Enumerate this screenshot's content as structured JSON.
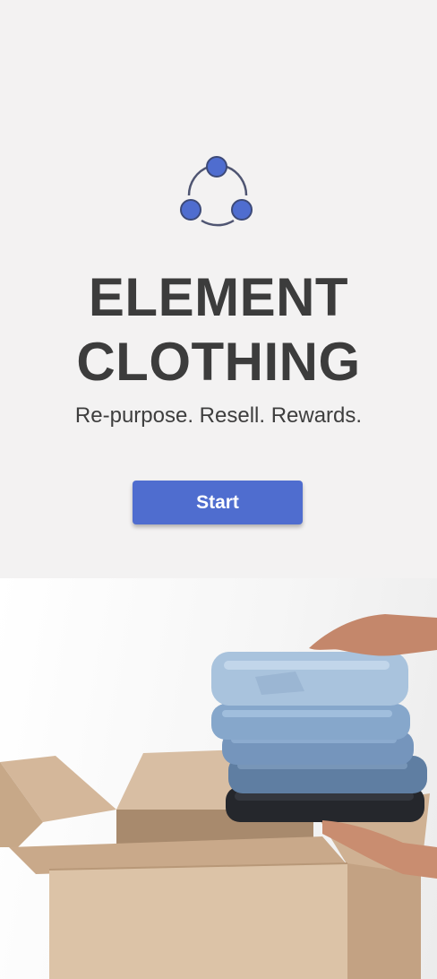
{
  "brand": {
    "title_line1": "ELEMENT",
    "title_line2": "CLOTHING",
    "tagline": "Re-purpose. Resell. Rewards.",
    "logo_icon": "share-network-icon",
    "accent_color": "#4f6dcf"
  },
  "actions": {
    "start_label": "Start"
  },
  "hero": {
    "image": "hands-holding-stacked-jeans-over-cardboard-box"
  }
}
